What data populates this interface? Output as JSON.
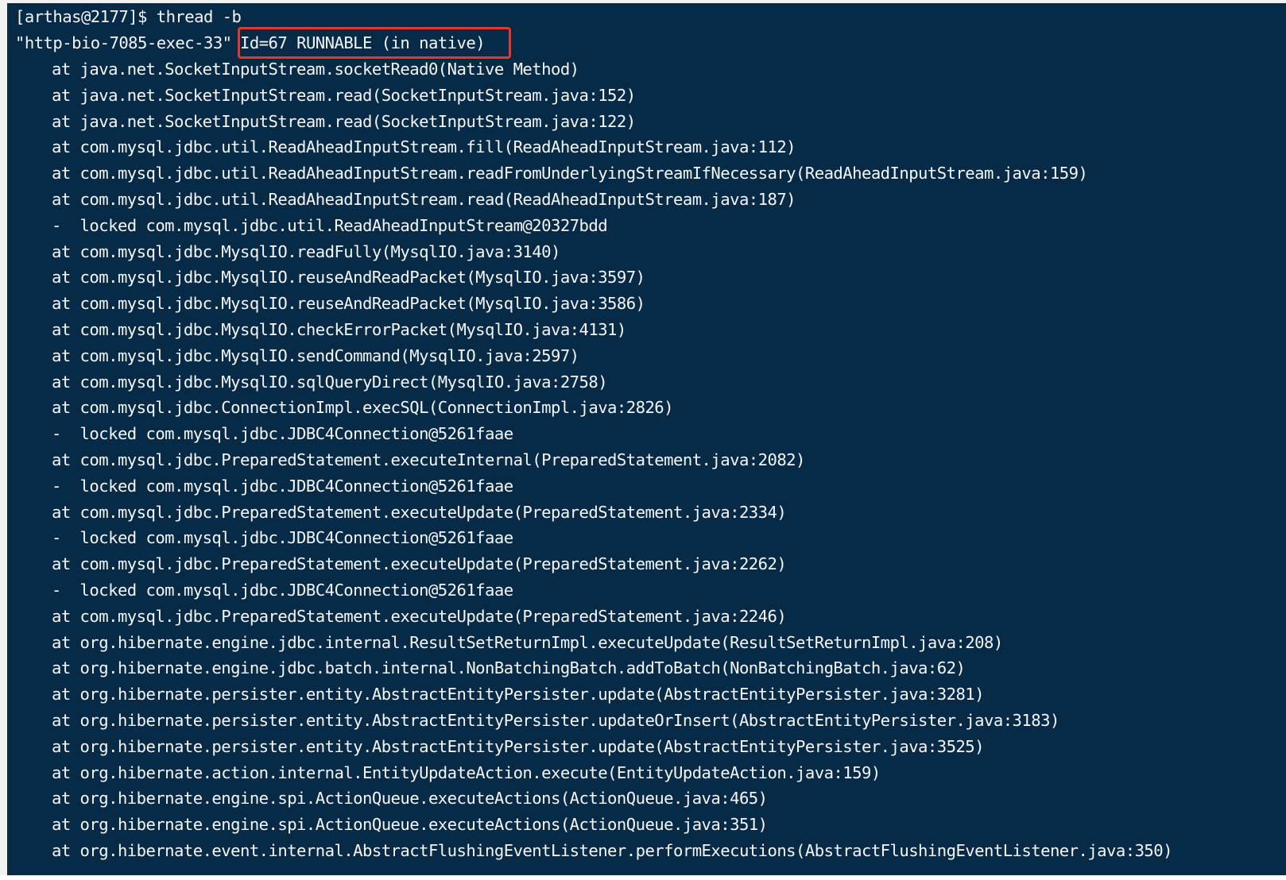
{
  "terminal": {
    "prompt": "[arthas@2177]$ thread -b",
    "thread_name": "\"http-bio-7085-exec-33\"",
    "thread_state": "Id=67 RUNNABLE (in native)",
    "stack_lines": [
      "at java.net.SocketInputStream.socketRead0(Native Method)",
      "at java.net.SocketInputStream.read(SocketInputStream.java:152)",
      "at java.net.SocketInputStream.read(SocketInputStream.java:122)",
      "at com.mysql.jdbc.util.ReadAheadInputStream.fill(ReadAheadInputStream.java:112)",
      "at com.mysql.jdbc.util.ReadAheadInputStream.readFromUnderlyingStreamIfNecessary(ReadAheadInputStream.java:159)",
      "at com.mysql.jdbc.util.ReadAheadInputStream.read(ReadAheadInputStream.java:187)",
      "-  locked com.mysql.jdbc.util.ReadAheadInputStream@20327bdd",
      "at com.mysql.jdbc.MysqlIO.readFully(MysqlIO.java:3140)",
      "at com.mysql.jdbc.MysqlIO.reuseAndReadPacket(MysqlIO.java:3597)",
      "at com.mysql.jdbc.MysqlIO.reuseAndReadPacket(MysqlIO.java:3586)",
      "at com.mysql.jdbc.MysqlIO.checkErrorPacket(MysqlIO.java:4131)",
      "at com.mysql.jdbc.MysqlIO.sendCommand(MysqlIO.java:2597)",
      "at com.mysql.jdbc.MysqlIO.sqlQueryDirect(MysqlIO.java:2758)",
      "at com.mysql.jdbc.ConnectionImpl.execSQL(ConnectionImpl.java:2826)",
      "-  locked com.mysql.jdbc.JDBC4Connection@5261faae",
      "at com.mysql.jdbc.PreparedStatement.executeInternal(PreparedStatement.java:2082)",
      "-  locked com.mysql.jdbc.JDBC4Connection@5261faae",
      "at com.mysql.jdbc.PreparedStatement.executeUpdate(PreparedStatement.java:2334)",
      "-  locked com.mysql.jdbc.JDBC4Connection@5261faae",
      "at com.mysql.jdbc.PreparedStatement.executeUpdate(PreparedStatement.java:2262)",
      "-  locked com.mysql.jdbc.JDBC4Connection@5261faae",
      "at com.mysql.jdbc.PreparedStatement.executeUpdate(PreparedStatement.java:2246)",
      "at org.hibernate.engine.jdbc.internal.ResultSetReturnImpl.executeUpdate(ResultSetReturnImpl.java:208)",
      "at org.hibernate.engine.jdbc.batch.internal.NonBatchingBatch.addToBatch(NonBatchingBatch.java:62)",
      "at org.hibernate.persister.entity.AbstractEntityPersister.update(AbstractEntityPersister.java:3281)",
      "at org.hibernate.persister.entity.AbstractEntityPersister.updateOrInsert(AbstractEntityPersister.java:3183)",
      "at org.hibernate.persister.entity.AbstractEntityPersister.update(AbstractEntityPersister.java:3525)",
      "at org.hibernate.action.internal.EntityUpdateAction.execute(EntityUpdateAction.java:159)",
      "at org.hibernate.engine.spi.ActionQueue.executeActions(ActionQueue.java:465)",
      "at org.hibernate.engine.spi.ActionQueue.executeActions(ActionQueue.java:351)",
      "at org.hibernate.event.internal.AbstractFlushingEventListener.performExecutions(AbstractFlushingEventListener.java:350)"
    ]
  },
  "colors": {
    "background": "#072a46",
    "text": "#f4f6f8",
    "highlight": "#e8362d"
  }
}
